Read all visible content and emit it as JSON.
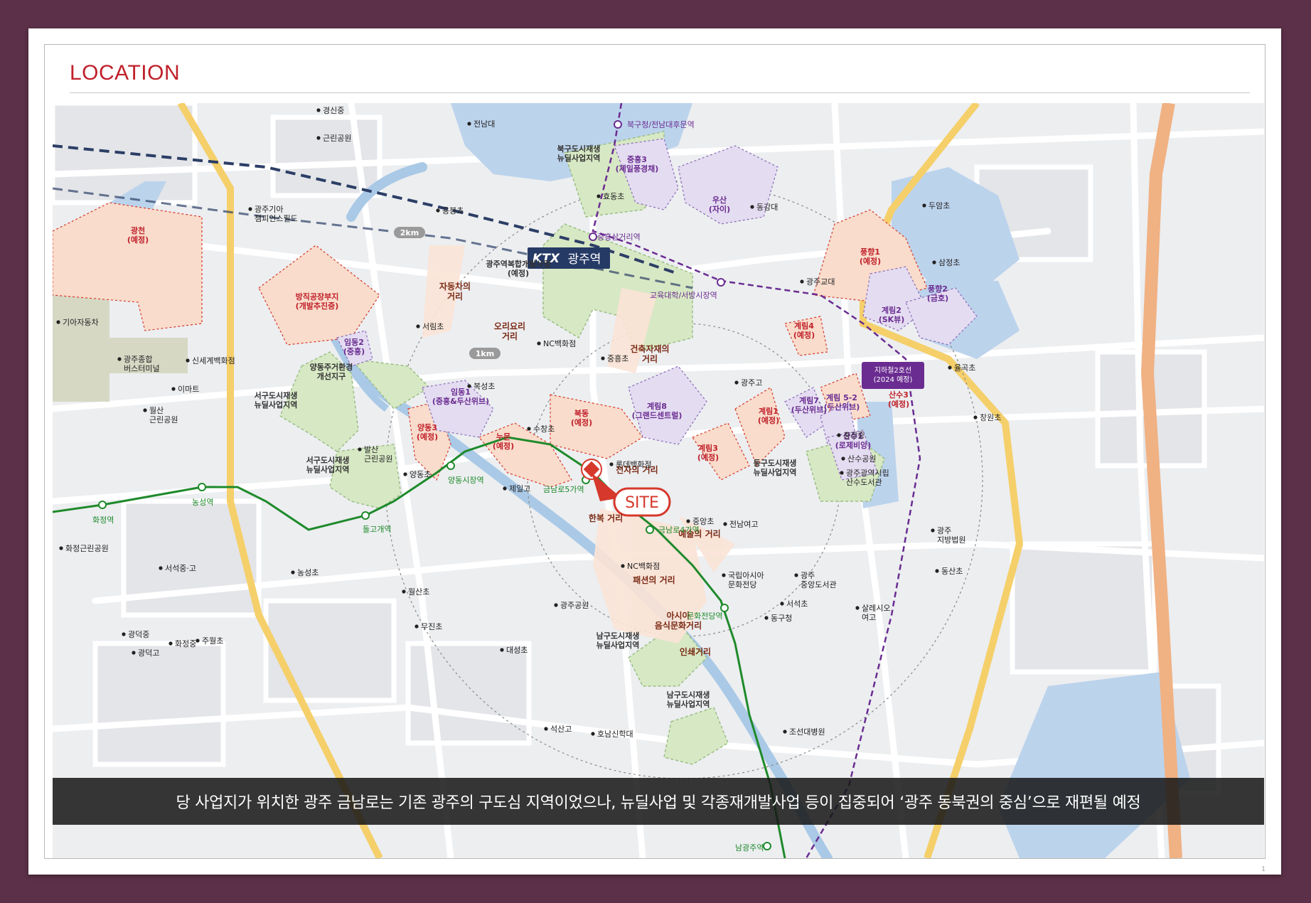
{
  "header": {
    "title": "LOCATION"
  },
  "caption": "당 사업지가 위치한 광주 금남로는 기존 광주의 구도심 지역이었으나, 뉴딜사업 및 각종재개발사업 등이 집중되어 ‘광주 동북권의 중심’으로 재편될 예정",
  "page_number": "1",
  "colors": {
    "accent_red": "#c0202a",
    "map_background": "#eceef0",
    "water": "#bcd3ec",
    "green_zone": "#d7e8c4",
    "orange_zone": "#f9dccb",
    "purple_zone": "#e4dcf1",
    "metro_line1": "#1e8a2a",
    "metro_line2": "#6a2c91",
    "yellow_road": "#f5cf6a",
    "rail": "#2c3e66"
  },
  "map": {
    "radius_labels": {
      "r2": "2km",
      "r1": "1km"
    },
    "ktx": {
      "logo": "KTX",
      "name": "광주역"
    },
    "site_label": "SITE",
    "line2_label": "지하철2호선\n(2024 예정)",
    "zones": {
      "gwangcheon": "광천\n(예정)",
      "bangjik": "방직공장부지\n(개발추진중)",
      "imdong2": "임동2\n(중흥)",
      "imdong1": "임동1\n(중흥&두산위브)",
      "yangdong3": "양동3\n(예정)",
      "numun": "누문\n(예정)",
      "bukdong": "북동\n(예정)",
      "jungheung3": "중흥3\n(제일풍경채)",
      "usan": "우산\n(자이)",
      "punghyang1": "풍향1\n(예정)",
      "punghyang2": "풍향2\n(금호)",
      "gyerim4": "계림4\n(예정)",
      "gyerim2": "계림2\n(SK뷰)",
      "gyerim8": "계림8\n(그랜드센트럴)",
      "gyerim1": "계림1\n(예정)",
      "gyerim3": "계림3\n(예정)",
      "gyerim7": "계림7\n(두산위브)",
      "gyerim52": "계림 5-2\n(두산위브)",
      "sansu3": "산수3\n(예정)",
      "sansu1": "산수1\n(로제비앙)",
      "ktx_complex": "광주역복합개발사업\n(예정)",
      "north_newdeal": "북구도시재생\n뉴딜사업지역",
      "west_newdeal1": "서구도시재생\n뉴딜사업지역",
      "west_newdeal2": "서구도시재생\n뉴딜사업지역",
      "yangdong_env": "양동주거환경\n개선지구",
      "east_newdeal": "동구도시재생\n뉴딜사업지역",
      "south_newdeal1": "남구도시재생\n뉴딜사업지역",
      "south_newdeal2": "남구도시재생\n뉴딜사업지역"
    },
    "streets": {
      "auto": "자동차의\n거리",
      "oriori": "오리요리\n거리",
      "construction": "건축자재의\n거리",
      "electronics": "전자의 거리",
      "hanbok": "한복 거리",
      "art": "예술의 거리",
      "fashion": "패션의 거리",
      "asia_food": "아시아\n음식문화거리",
      "print": "인쇄거리"
    },
    "stations": {
      "bukgu": "북구청/전남대후문역",
      "jungheung": "중흥삼거리역",
      "gyodae": "교육대학/서방시장역",
      "hwajeong": "화정역",
      "nongseong": "농성역",
      "dolgogae": "돌고개역",
      "yangdong": "양동시장역",
      "geumnam5": "금남로5가역",
      "geumnam4": "금남로4가역",
      "culture": "문화전당역",
      "namgwangju": "남광주역"
    },
    "places": {
      "gyeongsin": "경신중",
      "park": "근린공원",
      "jnu": "전남대",
      "champions": "광주기아\n챔피언스필드",
      "yongbong": "용봉초",
      "kia": "기아자동차",
      "terminal": "광주종합\n버스터미널",
      "shinsegae": "신세계백화점",
      "emart": "이마트",
      "wolsan_park": "월산\n근린공원",
      "seorim": "서림초",
      "nc1": "NC백화점",
      "jungheung_es": "중흥초",
      "bokseong": "복성초",
      "suchang": "수창초",
      "balsan": "발산\n근린공원",
      "yangdong_es": "양동초",
      "jeil": "제일고",
      "lotte": "롯데백화점",
      "hyodong": "효동초",
      "dongkang": "동강대",
      "gyodae_univ": "광주교대",
      "gwangju_hs": "광주고",
      "duam": "두암초",
      "samjeong": "삼정초",
      "yulgok": "율곡초",
      "changwon": "창원초",
      "chungjang": "충장중",
      "sansu_park": "산수공원",
      "library": "광주광역시립\n산수도서관",
      "court": "광주\n지방법원",
      "dongsan": "동산초",
      "jungang_es": "중앙초",
      "jnu_hs": "전남여고",
      "nc2": "NC백화점",
      "acc": "국립아시아\n문화전당",
      "jungang_lib": "광주\n중앙도서관",
      "seoseok": "서석초",
      "dong_office": "동구청",
      "salesio": "살레시오\n여고",
      "hwajeong_park": "화정근린공원",
      "seoseok_ms": "서석중·고",
      "nongseong_es": "농성초",
      "wolsan_es": "월산초",
      "gwangju_park": "광주공원",
      "mujin": "무진초",
      "gwangdeok_ms": "광덕중",
      "gwangdeok_hs": "광덕고",
      "hwajeong_ms": "화정중",
      "juwol": "주월초",
      "daeseong": "대성초",
      "seoksan": "석산고",
      "honam": "호남신학대",
      "chosun": "조선대병원"
    }
  }
}
